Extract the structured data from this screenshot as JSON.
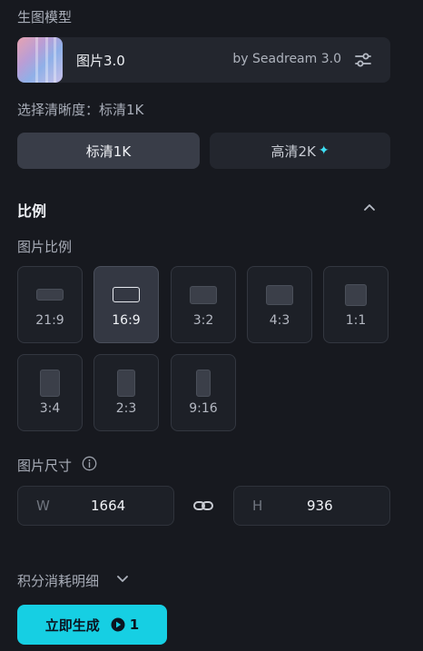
{
  "model_section": {
    "title": "生图模型"
  },
  "model": {
    "name": "图片3.0",
    "by": "by Seadream 3.0",
    "settings_icon": "sliders-icon"
  },
  "quality": {
    "label": "选择清晰度：标清1K",
    "options": [
      {
        "label": "标清1K",
        "selected": true
      },
      {
        "label": "高清2K",
        "selected": false,
        "badge_icon": "sparkle-icon"
      }
    ]
  },
  "ratio_section": {
    "title": "比例",
    "collapse_icon": "chevron-up-icon"
  },
  "aspect": {
    "label": "图片比例",
    "options": [
      {
        "label": "21:9",
        "selected": false
      },
      {
        "label": "16:9",
        "selected": true
      },
      {
        "label": "3:2",
        "selected": false
      },
      {
        "label": "4:3",
        "selected": false
      },
      {
        "label": "1:1",
        "selected": false
      },
      {
        "label": "3:4",
        "selected": false
      },
      {
        "label": "2:3",
        "selected": false
      },
      {
        "label": "9:16",
        "selected": false
      }
    ]
  },
  "size": {
    "label": "图片尺寸",
    "info_icon": "info-icon",
    "width_prefix": "W",
    "width_value": "1664",
    "link_icon": "link-icon",
    "height_prefix": "H",
    "height_value": "936"
  },
  "credits": {
    "label": "积分消耗明细",
    "chevron_icon": "chevron-down-icon"
  },
  "generate": {
    "label": "立即生成",
    "credit_icon": "credit-icon",
    "cost": "1"
  },
  "colors": {
    "background": "#17191f",
    "accent": "#16cfe3"
  }
}
